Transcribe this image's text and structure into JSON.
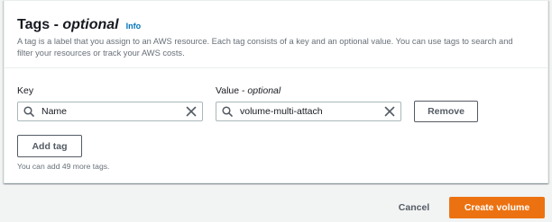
{
  "section": {
    "title_main": "Tags - ",
    "title_optional": "optional",
    "info_link": "Info",
    "description": "A tag is a label that you assign to an AWS resource. Each tag consists of a key and an optional value. You can use tags to search and filter your resources or track your AWS costs."
  },
  "tags": {
    "key_label": "Key",
    "value_label_main": "Value - ",
    "value_label_optional": "optional",
    "rows": [
      {
        "key": "Name",
        "value": "volume-multi-attach",
        "remove_label": "Remove"
      }
    ],
    "add_tag_label": "Add tag",
    "remaining_hint": "You can add 49 more tags."
  },
  "footer": {
    "cancel_label": "Cancel",
    "create_label": "Create volume"
  },
  "colors": {
    "primary": "#ec7211",
    "link": "#0073bb",
    "text": "#16191f",
    "muted": "#687078",
    "background": "#f2f3f3"
  },
  "icons": [
    "search-icon",
    "clear-icon"
  ]
}
